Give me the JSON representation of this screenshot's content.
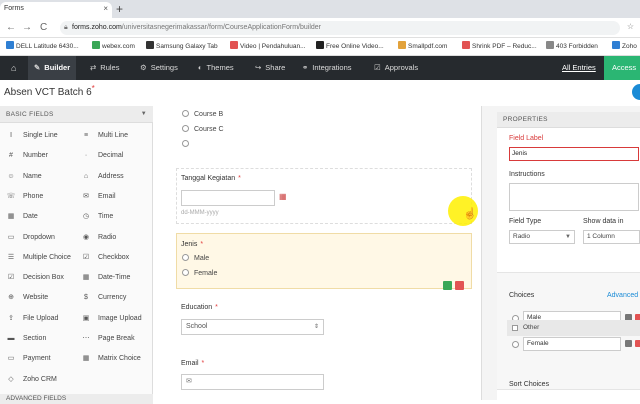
{
  "browser": {
    "tab_title": "Forms",
    "tab_close": "×",
    "new_tab": "+",
    "back": "←",
    "forward": "→",
    "reload": "C",
    "url_host": "forms.zoho.com",
    "url_path": "/universitasnegerimakassar/form/CourseApplicationForm/builder",
    "bookmarks": [
      "DELL Latitude 6430...",
      "webex.com",
      "Samsung Galaxy Tab",
      "Video | Pendahuluan...",
      "Free Online Video...",
      "Smallpdf.com",
      "Shrink PDF – Reduc...",
      "403 Forbidden",
      "Zoho"
    ]
  },
  "toolbar": {
    "home_icon": "home-icon",
    "builder": "Builder",
    "rules": "Rules",
    "settings": "Settings",
    "themes": "Themes",
    "share": "Share",
    "integrations": "Integrations",
    "approvals": "Approvals",
    "all_entries": "All Entries",
    "access": "Access F"
  },
  "form_title": "Absen VCT Batch 6",
  "form_title_marker": "*",
  "left_panel": {
    "heading": "BASIC FIELDS",
    "col1": [
      {
        "label": "Single Line",
        "icon": "Ⅰ"
      },
      {
        "label": "Number",
        "icon": "#"
      },
      {
        "label": "Name",
        "icon": "☺"
      },
      {
        "label": "Phone",
        "icon": "☏"
      },
      {
        "label": "Date",
        "icon": "▦"
      },
      {
        "label": "Dropdown",
        "icon": "▭"
      },
      {
        "label": "Multiple Choice",
        "icon": "☰"
      },
      {
        "label": "Decision Box",
        "icon": "☑"
      },
      {
        "label": "Website",
        "icon": "⊕"
      },
      {
        "label": "File Upload",
        "icon": "⇪"
      },
      {
        "label": "Section",
        "icon": "▬"
      },
      {
        "label": "Payment",
        "icon": "▭"
      },
      {
        "label": "Zoho CRM",
        "icon": "◇"
      }
    ],
    "col2": [
      {
        "label": "Multi Line",
        "icon": "≡"
      },
      {
        "label": "Decimal",
        "icon": "·"
      },
      {
        "label": "Address",
        "icon": "⌂"
      },
      {
        "label": "Email",
        "icon": "✉"
      },
      {
        "label": "Time",
        "icon": "◷"
      },
      {
        "label": "Radio",
        "icon": "◉"
      },
      {
        "label": "Checkbox",
        "icon": "☑"
      },
      {
        "label": "Date-Time",
        "icon": "▦"
      },
      {
        "label": "Currency",
        "icon": "$"
      },
      {
        "label": "Image Upload",
        "icon": "▣"
      },
      {
        "label": "Page Break",
        "icon": "⋯"
      },
      {
        "label": "Matrix Choice",
        "icon": "▦"
      }
    ],
    "advanced_heading": "ADVANCED FIELDS"
  },
  "canvas": {
    "course_options": [
      "Course B",
      "Course C",
      ""
    ],
    "date_label": "Tanggal Kegiatan",
    "date_hint": "dd-MMM-yyyy",
    "jenis_label": "Jenis",
    "jenis_options": [
      "Male",
      "Female"
    ],
    "education_label": "Education",
    "education_value": "School",
    "email_label": "Email",
    "required_mark": "*"
  },
  "properties": {
    "heading": "PROPERTIES",
    "field_label_title": "Field Label",
    "field_label_value": "Jenis",
    "instructions_title": "Instructions",
    "field_type_title": "Field Type",
    "field_type_value": "Radio",
    "show_data_title": "Show data in",
    "show_data_value": "1 Column",
    "choices_title": "Choices",
    "advanced_link": "Advanced",
    "choices": [
      "Male",
      "Female"
    ],
    "other_label": "Other",
    "sort_title": "Sort Choices"
  }
}
